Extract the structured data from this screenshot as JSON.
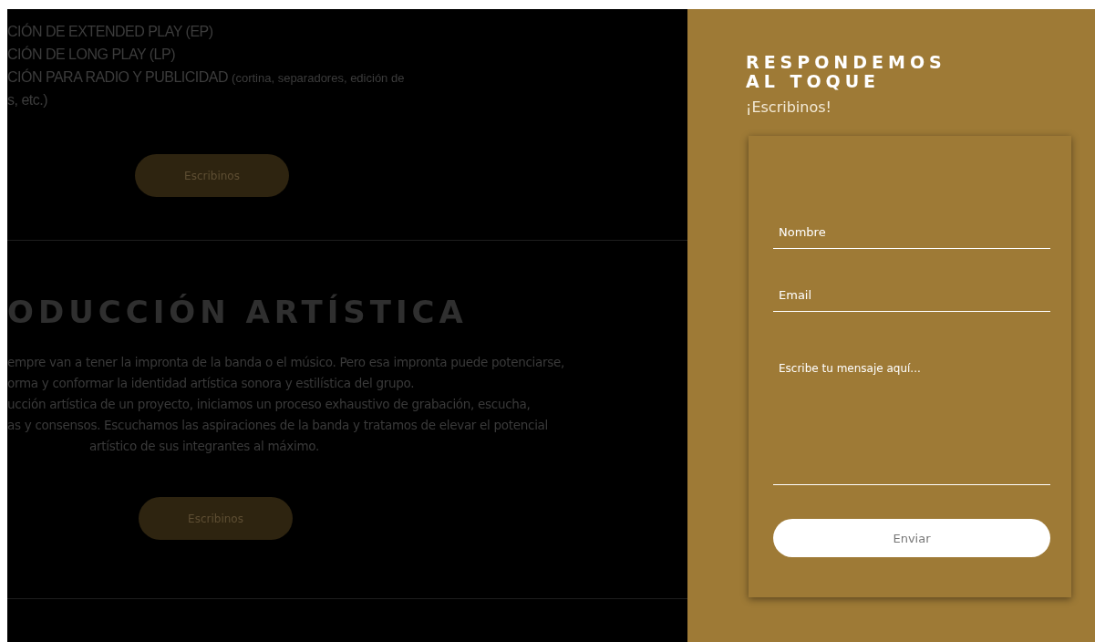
{
  "services": {
    "items": [
      {
        "text": "CIÓN DE EXTENDED PLAY (EP)"
      },
      {
        "text": "CIÓN DE LONG PLAY (LP)"
      },
      {
        "text": "CIÓN PARA RADIO Y PUBLICIDAD",
        "note": "(cortina, separadores, edición de"
      },
      {
        "text": "s, etc.)"
      }
    ],
    "button": "Escribinos"
  },
  "production": {
    "title": "ODUCCIÓN ARTÍSTICA",
    "lines": [
      "empre van a tener la impronta de la banda o el músico. Pero esa impronta puede potenciarse,",
      "orma y conformar la identidad artística sonora y estilística del grupo.",
      "ucción artística de un proyecto, iniciamos un proceso exhaustivo de grabación, escucha,",
      "as y consensos. Escuchamos las aspiraciones de la banda y tratamos de elevar el potencial",
      "artístico de sus integrantes al máximo."
    ],
    "button": "Escribinos"
  },
  "contact": {
    "title_lines": [
      "RESPONDEMOS",
      "AL TOQUE"
    ],
    "subtitle": "¡Escribinos!",
    "fields": [
      {
        "kind": "input",
        "placeholder": "Nombre"
      },
      {
        "kind": "input",
        "placeholder": "Email"
      },
      {
        "kind": "textarea",
        "placeholder": "Escribe tu mensaje aquí..."
      }
    ],
    "submit": "Enviar"
  }
}
